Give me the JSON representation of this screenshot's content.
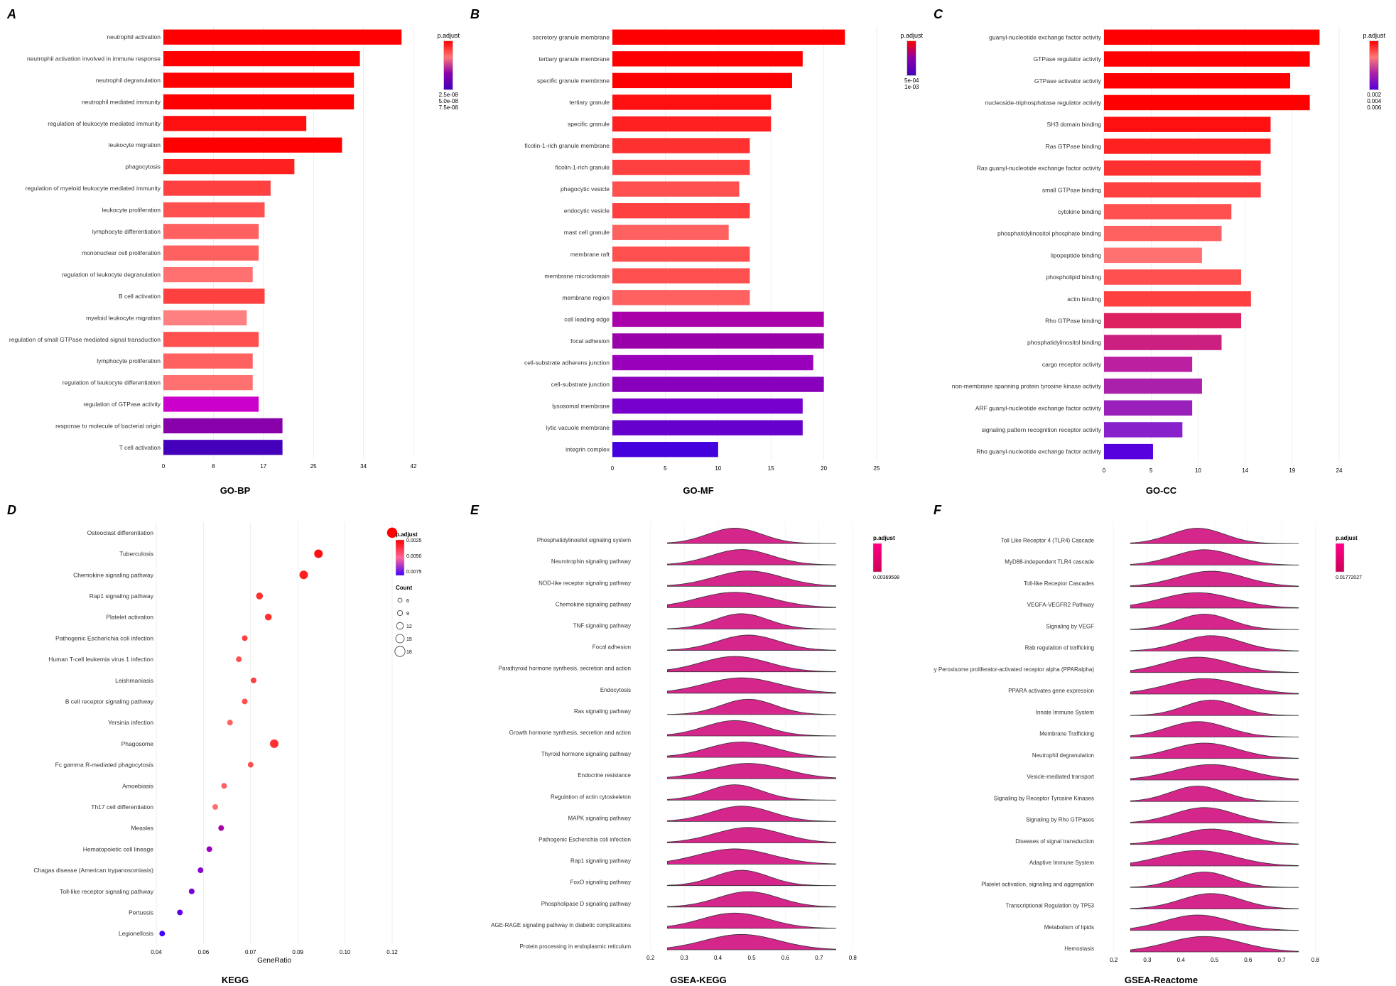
{
  "panels": {
    "A": {
      "label": "A",
      "title": "GO-BP",
      "items": [
        {
          "name": "neutrophil activation",
          "value": 40,
          "color": "#FF0000"
        },
        {
          "name": "neutrophil activation involved in immune response",
          "value": 33,
          "color": "#FF0000"
        },
        {
          "name": "neutrophil degranulation",
          "value": 32,
          "color": "#FF0000"
        },
        {
          "name": "neutrophil mediated immunity",
          "value": 32,
          "color": "#FF0000"
        },
        {
          "name": "regulation of leukocyte mediated immunity",
          "value": 24,
          "color": "#FF1010"
        },
        {
          "name": "leukocyte migration",
          "value": 30,
          "color": "#FF0000"
        },
        {
          "name": "phagocytosis",
          "value": 22,
          "color": "#FF2020"
        },
        {
          "name": "regulation of myeloid leukocyte mediated immunity",
          "value": 18,
          "color": "#FF4040"
        },
        {
          "name": "leukocyte proliferation",
          "value": 17,
          "color": "#FF5050"
        },
        {
          "name": "lymphocyte differentiation",
          "value": 16,
          "color": "#FF6060"
        },
        {
          "name": "mononuclear cell proliferation",
          "value": 16,
          "color": "#FF6060"
        },
        {
          "name": "regulation of leukocyte degranulation",
          "value": 15,
          "color": "#FF7070"
        },
        {
          "name": "B cell activation",
          "value": 17,
          "color": "#FF4040"
        },
        {
          "name": "myeloid leukocyte migration",
          "value": 14,
          "color": "#FF8080"
        },
        {
          "name": "regulation of small GTPase mediated signal transduction",
          "value": 16,
          "color": "#FF5050"
        },
        {
          "name": "lymphocyte proliferation",
          "value": 15,
          "color": "#FF6060"
        },
        {
          "name": "regulation of leukocyte differentiation",
          "value": 15,
          "color": "#FF7070"
        },
        {
          "name": "regulation of GTPase activity",
          "value": 16,
          "color": "#CC00CC"
        },
        {
          "name": "response to molecule of bacterial origin",
          "value": 20,
          "color": "#8800AA"
        },
        {
          "name": "T cell activation",
          "value": 20,
          "color": "#4400BB"
        }
      ],
      "maxValue": 42,
      "legend": {
        "title": "p.adjust",
        "values": [
          "2.5e-08",
          "5.0e-08",
          "7.5e-08"
        ]
      }
    },
    "B": {
      "label": "B",
      "title": "GO-MF",
      "items": [
        {
          "name": "secretory granule membrane",
          "value": 22,
          "color": "#FF0000"
        },
        {
          "name": "tertiary granule membrane",
          "value": 18,
          "color": "#FF0000"
        },
        {
          "name": "specific granule membrane",
          "value": 17,
          "color": "#FF0000"
        },
        {
          "name": "tertiary granule",
          "value": 15,
          "color": "#FF1010"
        },
        {
          "name": "specific granule",
          "value": 15,
          "color": "#FF2020"
        },
        {
          "name": "ficolin-1-rich granule membrane",
          "value": 13,
          "color": "#FF3030"
        },
        {
          "name": "ficolin-1-rich granule",
          "value": 13,
          "color": "#FF4040"
        },
        {
          "name": "phagocytic vesicle",
          "value": 12,
          "color": "#FF5050"
        },
        {
          "name": "endocytic vesicle",
          "value": 13,
          "color": "#FF4040"
        },
        {
          "name": "mast cell granule",
          "value": 11,
          "color": "#FF6060"
        },
        {
          "name": "membrane raft",
          "value": 13,
          "color": "#FF5050"
        },
        {
          "name": "membrane microdomain",
          "value": 13,
          "color": "#FF5050"
        },
        {
          "name": "membrane region",
          "value": 13,
          "color": "#FF6060"
        },
        {
          "name": "cell leading edge",
          "value": 20,
          "color": "#AA00AA"
        },
        {
          "name": "focal adhesion",
          "value": 20,
          "color": "#9900AA"
        },
        {
          "name": "cell-substrate adherens junction",
          "value": 19,
          "color": "#9900BB"
        },
        {
          "name": "cell-substrate junction",
          "value": 20,
          "color": "#8800BB"
        },
        {
          "name": "lysosomal membrane",
          "value": 18,
          "color": "#7700CC"
        },
        {
          "name": "lytic vacuole membrane",
          "value": 18,
          "color": "#6600CC"
        },
        {
          "name": "integrin complex",
          "value": 10,
          "color": "#4400DD"
        }
      ],
      "maxValue": 25,
      "legend": {
        "title": "p.adjust",
        "values": [
          "5e-04",
          "1e-03"
        ]
      }
    },
    "C": {
      "label": "C",
      "title": "GO-CC",
      "items": [
        {
          "name": "guanyl-nucleotide exchange factor activity",
          "value": 22,
          "color": "#FF0000"
        },
        {
          "name": "GTPase regulator activity",
          "value": 21,
          "color": "#FF0000"
        },
        {
          "name": "GTPase activator activity",
          "value": 19,
          "color": "#FF0000"
        },
        {
          "name": "nucleoside-triphosphatase regulator activity",
          "value": 21,
          "color": "#FF0000"
        },
        {
          "name": "SH3 domain binding",
          "value": 17,
          "color": "#FF1010"
        },
        {
          "name": "Ras GTPase binding",
          "value": 17,
          "color": "#FF2020"
        },
        {
          "name": "Ras guanyl-nucleotide exchange factor activity",
          "value": 16,
          "color": "#FF3030"
        },
        {
          "name": "small GTPase binding",
          "value": 16,
          "color": "#FF4040"
        },
        {
          "name": "cytokine binding",
          "value": 13,
          "color": "#FF5050"
        },
        {
          "name": "phosphatidylinositol phosphate binding",
          "value": 12,
          "color": "#FF6060"
        },
        {
          "name": "lipopeptide binding",
          "value": 10,
          "color": "#FF7070"
        },
        {
          "name": "phospholipid binding",
          "value": 14,
          "color": "#FF5050"
        },
        {
          "name": "actin binding",
          "value": 15,
          "color": "#FF4040"
        },
        {
          "name": "Rho GTPase binding",
          "value": 14,
          "color": "#DD2060"
        },
        {
          "name": "phosphatidylinositol binding",
          "value": 12,
          "color": "#CC2080"
        },
        {
          "name": "cargo receptor activity",
          "value": 9,
          "color": "#BB20A0"
        },
        {
          "name": "non-membrane spanning protein tyrosine kinase activity",
          "value": 10,
          "color": "#AA20AA"
        },
        {
          "name": "ARF guanyl-nucleotide exchange factor activity",
          "value": 9,
          "color": "#9920BB"
        },
        {
          "name": "signaling pattern recognition receptor activity",
          "value": 8,
          "color": "#8820CC"
        },
        {
          "name": "Rho guanyl-nucleotide exchange factor activity",
          "value": 5,
          "color": "#5500DD"
        }
      ],
      "maxValue": 24,
      "legend": {
        "title": "p.adjust",
        "values": [
          "0.002",
          "0.004",
          "0.006"
        ]
      }
    },
    "D": {
      "label": "D",
      "title": "KEGG",
      "items": [
        {
          "name": "Osteoclast differentiation",
          "x": 0.12,
          "size": 18,
          "color": "#FF0000"
        },
        {
          "name": "Tuberculosis",
          "x": 0.095,
          "size": 15,
          "color": "#FF1010"
        },
        {
          "name": "Chemokine signaling pathway",
          "x": 0.09,
          "size": 15,
          "color": "#FF2020"
        },
        {
          "name": "Rap1 signaling pathway",
          "x": 0.075,
          "size": 12,
          "color": "#FF3030"
        },
        {
          "name": "Platelet activation",
          "x": 0.078,
          "size": 12,
          "color": "#FF3030"
        },
        {
          "name": "Pathogenic Escherichia coli infection",
          "x": 0.07,
          "size": 9,
          "color": "#FF4040"
        },
        {
          "name": "Human T-cell leukemia virus 1 infection",
          "x": 0.068,
          "size": 9,
          "color": "#FF5050"
        },
        {
          "name": "Leishmaniasis",
          "x": 0.073,
          "size": 9,
          "color": "#FF4040"
        },
        {
          "name": "B cell receptor signaling pathway",
          "x": 0.07,
          "size": 9,
          "color": "#FF5050"
        },
        {
          "name": "Yersinia infection",
          "x": 0.065,
          "size": 9,
          "color": "#FF6060"
        },
        {
          "name": "Phagosome",
          "x": 0.08,
          "size": 15,
          "color": "#FF3030"
        },
        {
          "name": "Fc gamma R-mediated phagocytosis",
          "x": 0.072,
          "size": 9,
          "color": "#FF5050"
        },
        {
          "name": "Amoebiasis",
          "x": 0.063,
          "size": 6,
          "color": "#FF6060"
        },
        {
          "name": "Th17 cell differentiation",
          "x": 0.06,
          "size": 6,
          "color": "#FF7070"
        },
        {
          "name": "Measles",
          "x": 0.062,
          "size": 6,
          "color": "#AA00AA"
        },
        {
          "name": "Hematopoietic cell lineage",
          "x": 0.058,
          "size": 6,
          "color": "#9900BB"
        },
        {
          "name": "Chagas disease (American trypanosomiasis)",
          "x": 0.055,
          "size": 6,
          "color": "#8800CC"
        },
        {
          "name": "Toll-like receptor signaling pathway",
          "x": 0.052,
          "size": 6,
          "color": "#7700DD"
        },
        {
          "name": "Pertussis",
          "x": 0.048,
          "size": 6,
          "color": "#6600EE"
        },
        {
          "name": "Legionellosis",
          "x": 0.042,
          "size": 6,
          "color": "#4400FF"
        }
      ],
      "xMin": 0.04,
      "xMax": 0.12,
      "legend": {
        "title": "p.adjust",
        "countTitle": "Count",
        "values": [
          "0.0025",
          "0.0050",
          "0.0075"
        ],
        "counts": [
          6,
          9,
          12,
          15,
          18
        ]
      }
    },
    "E": {
      "label": "E",
      "title": "GSEA-KEGG",
      "items": [
        {
          "name": "Phosphatidylinositol signaling system"
        },
        {
          "name": "Neurotrophin signaling pathway"
        },
        {
          "name": "NOD-like receptor signaling pathway"
        },
        {
          "name": "Chemokine signaling pathway"
        },
        {
          "name": "TNF signaling pathway"
        },
        {
          "name": "Focal adhesion"
        },
        {
          "name": "Parathyroid hormone synthesis, secretion and action"
        },
        {
          "name": "Endocytosis"
        },
        {
          "name": "Ras signaling pathway"
        },
        {
          "name": "Growth hormone synthesis, secretion and action"
        },
        {
          "name": "Thyroid hormone signaling pathway"
        },
        {
          "name": "Endocrine resistance"
        },
        {
          "name": "Regulation of actin cytoskeleton"
        },
        {
          "name": "MAPK signaling pathway"
        },
        {
          "name": "Pathogenic Escherichia coli infection"
        },
        {
          "name": "Rap1 signaling pathway"
        },
        {
          "name": "FoxO signaling pathway"
        },
        {
          "name": "Phospholipase D signaling pathway"
        },
        {
          "name": "AGE-RAGE signaling pathway in diabetic complications"
        },
        {
          "name": "Protein processing in endoplasmic reticulum"
        }
      ],
      "legend": {
        "padjust": "0.00369598"
      }
    },
    "F": {
      "label": "F",
      "title": "GSEA-Reactome",
      "items": [
        {
          "name": "Toll Like Receptor 4 (TLR4) Cascade"
        },
        {
          "name": "MyD88-independent TLR4 cascade"
        },
        {
          "name": "Toll-like Receptor Cascades"
        },
        {
          "name": "VEGFA-VEGFR2 Pathway"
        },
        {
          "name": "Signaling by VEGF"
        },
        {
          "name": "Rab regulation of trafficking"
        },
        {
          "name": "Regulation of lipid metabolism by Peroxisome proliferator-activated receptor alpha (PPARalpha)"
        },
        {
          "name": "PPARA activates gene expression"
        },
        {
          "name": "Innate Immune System"
        },
        {
          "name": "Membrane Trafficking"
        },
        {
          "name": "Neutrophil degranulation"
        },
        {
          "name": "Vesicle-mediated transport"
        },
        {
          "name": "Signaling by Receptor Tyrosine Kinases"
        },
        {
          "name": "Signaling by Rho GTPases"
        },
        {
          "name": "Diseases of signal transduction"
        },
        {
          "name": "Adaptive Immune System"
        },
        {
          "name": "Platelet activation, signaling and aggregation"
        },
        {
          "name": "Transcriptional Regulation by TP53"
        },
        {
          "name": "Metabolism of lipids"
        },
        {
          "name": "Hemostasis"
        }
      ],
      "legend": {
        "padjust": "0.01772027"
      }
    }
  }
}
